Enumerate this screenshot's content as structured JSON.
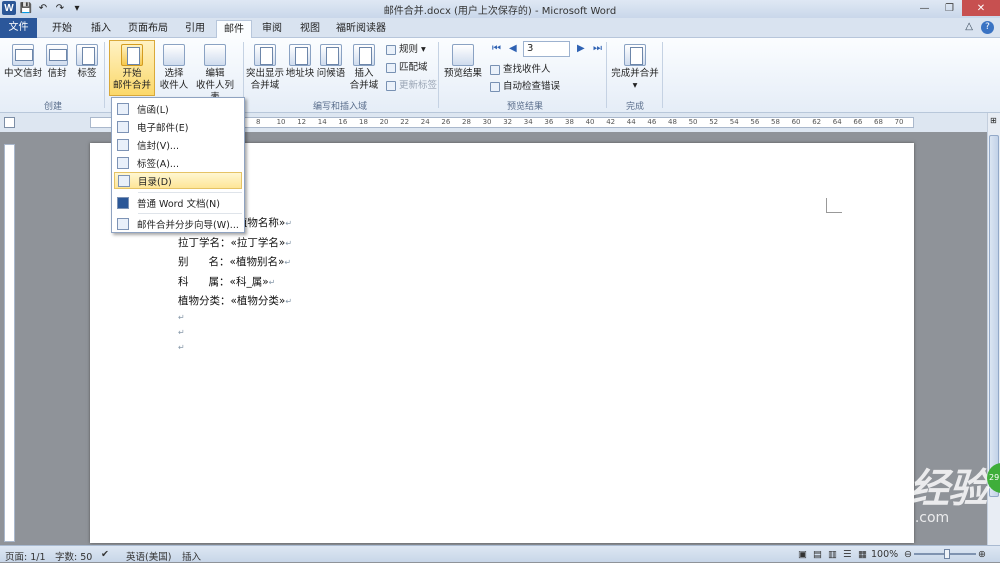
{
  "titlebar": {
    "title": "邮件合并.docx (用户上次保存的) - Microsoft Word",
    "app_icon": "W"
  },
  "tabs": {
    "file": "文件",
    "home": "开始",
    "insert": "插入",
    "page_layout": "页面布局",
    "references": "引用",
    "mailings": "邮件",
    "review": "审阅",
    "view": "视图",
    "reader": "福昕阅读器"
  },
  "ribbon": {
    "create": {
      "chinese_envelope": "中文信封",
      "envelopes": "信封",
      "labels": "标签",
      "group": "创建"
    },
    "start": {
      "start_l1": "开始",
      "start_l2": "邮件合并",
      "select_l1": "选择",
      "select_l2": "收件人",
      "edit_l1": "编辑",
      "edit_l2": "收件人列表"
    },
    "write": {
      "highlight_l1": "突出显示",
      "highlight_l2": "合并域",
      "address": "地址块",
      "greeting": "问候语",
      "insert_l1": "插入",
      "insert_l2": "合并域",
      "rules": "规则",
      "match": "匹配域",
      "update": "更新标签",
      "group": "编写和插入域"
    },
    "preview": {
      "preview_results": "预览结果",
      "record": "3",
      "find": "查找收件人",
      "auto_check": "自动检查错误",
      "group": "预览结果"
    },
    "finish": {
      "finish_l1": "完成并合并",
      "group": "完成"
    }
  },
  "menu": {
    "items": [
      "信函(L)",
      "电子邮件(E)",
      "信封(V)...",
      "标签(A)...",
      "目录(D)",
      "普通 Word 文档(N)",
      "邮件合并分步向导(W)..."
    ]
  },
  "document": {
    "lines": [
      "植物名称：«植物名称»",
      "拉丁学名：«拉丁学名»",
      "别      名：«植物别名»",
      "科      属：«科_属»",
      "植物分类：«植物分类»"
    ],
    "mark": "↵"
  },
  "ruler": {
    "ticks": [
      "8",
      "10",
      "12",
      "14",
      "16",
      "18",
      "20",
      "22",
      "24",
      "26",
      "28",
      "30",
      "32",
      "34",
      "36",
      "38",
      "40",
      "42",
      "44",
      "46",
      "48",
      "50",
      "52",
      "54",
      "56",
      "58",
      "60",
      "62",
      "64",
      "66",
      "68",
      "70"
    ]
  },
  "statusbar": {
    "page": "页面: 1/1",
    "words": "字数: 50",
    "language": "英语(美国)",
    "mode": "插入",
    "zoom": "100%"
  },
  "watermark": {
    "logo": "Bai du 经验",
    "url": "jingyan.baidu.com"
  },
  "badge": "29",
  "colors": {
    "file_tab": "#2b579a",
    "menu_highlight": "#fde597"
  }
}
